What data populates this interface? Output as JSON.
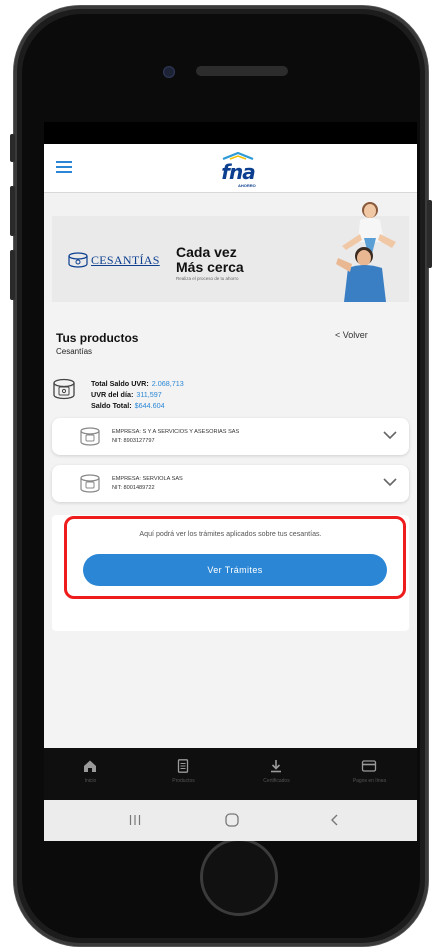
{
  "header": {
    "logo_text": "fna",
    "logo_subtext": "AHORRO"
  },
  "banner": {
    "brand": "CESANTÍAS",
    "line1": "Cada vez",
    "line2": "Más cerca",
    "tagline": "Realiza el proceso de tu ahorro"
  },
  "products": {
    "title": "Tus productos",
    "subtitle": "Cesantías",
    "back_label": "< Volver",
    "totals": {
      "uvr_label": "Total Saldo UVR:",
      "uvr_value": "2.068,713",
      "uvr_day_label": "UVR del día:",
      "uvr_day_value": "311,597",
      "saldo_label": "Saldo Total:",
      "saldo_value": "$644.604"
    },
    "companies": [
      {
        "name": "EMPRESA: S Y A SERVICIOS Y ASESORIAS SAS",
        "nit": "NIT: 8903127797"
      },
      {
        "name": "EMPRESA: SERVIOLA SAS",
        "nit": "NIT: 8001489722"
      }
    ],
    "tramites_info": "Aquí podrá ver los trámites aplicados sobre tus cesantías.",
    "tramites_button": "Ver Trámites"
  },
  "tabbar": {
    "tabs": [
      {
        "label": "Inicio",
        "icon": "home-icon"
      },
      {
        "label": "Productos",
        "icon": "document-icon"
      },
      {
        "label": "Certificados",
        "icon": "download-icon"
      },
      {
        "label": "Pagos en línea",
        "icon": "card-icon"
      }
    ]
  },
  "colors": {
    "accent": "#2b87d6",
    "brand": "#0c3f8f",
    "highlight": "#ee1c1c"
  }
}
